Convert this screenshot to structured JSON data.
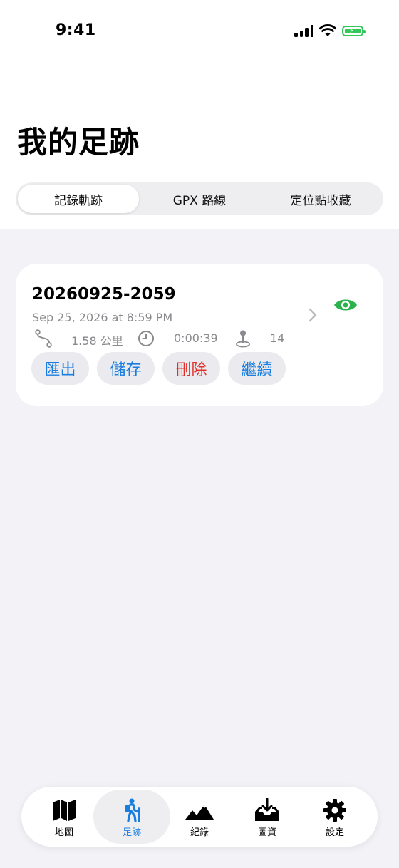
{
  "status_bar": {
    "time": "9:41"
  },
  "page_title": "我的足跡",
  "segments": [
    "記錄軌跡",
    "GPX 路線",
    "定位點收藏"
  ],
  "track": {
    "name": "20260925-2059",
    "date": "Sep 25, 2026 at 8:59 PM",
    "distance": "1.58 公里",
    "duration": "0:00:39",
    "points": "14",
    "actions": {
      "export": "匯出",
      "save": "儲存",
      "delete": "刪除",
      "continue": "繼續"
    }
  },
  "tabbar": {
    "items": [
      "地圖",
      "足跡",
      "紀錄",
      "圖資",
      "設定"
    ],
    "active": "足跡"
  },
  "colors": {
    "accent": "#1a7ee0",
    "eye": "#2bb24c",
    "danger": "#e0302a",
    "battery": "#34c759"
  },
  "icons": {
    "stats": [
      "route-icon",
      "clock-icon",
      "pin-icon"
    ],
    "tabs": [
      "map-icon",
      "hiker-icon",
      "mountains-icon",
      "download-tray-icon",
      "gear-icon"
    ]
  }
}
